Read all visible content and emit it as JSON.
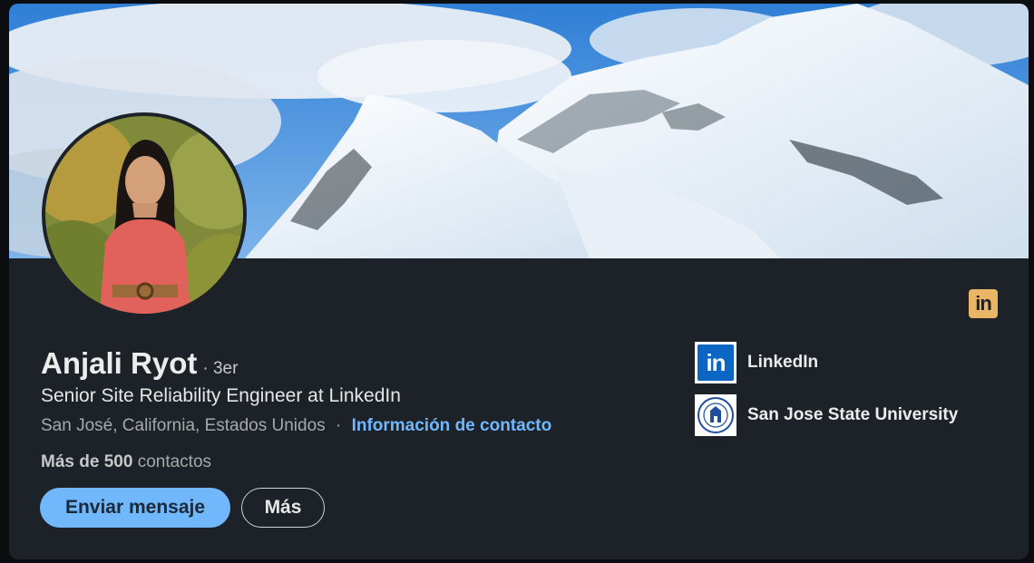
{
  "profile": {
    "name": "Anjali Ryot",
    "degree": "· 3er",
    "headline": "Senior Site Reliability Engineer at LinkedIn",
    "location": "San José, California, Estados Unidos",
    "location_separator": "·",
    "contact_link": "Información de contacto",
    "connections_count": "Más de 500",
    "connections_label": "contactos"
  },
  "actions": {
    "message_label": "Enviar mensaje",
    "more_label": "Más"
  },
  "badge": {
    "icon": "linkedin-icon",
    "text": "in",
    "color": "#e8b664"
  },
  "organizations": [
    {
      "name": "LinkedIn",
      "logo_text": "in",
      "icon": "linkedin-logo-icon"
    },
    {
      "name": "San Jose State University",
      "icon": "sjsu-seal-icon"
    }
  ],
  "colors": {
    "card_background": "#1d2228",
    "accent": "#71b7fb",
    "linkedin_blue": "#0a66c2"
  }
}
